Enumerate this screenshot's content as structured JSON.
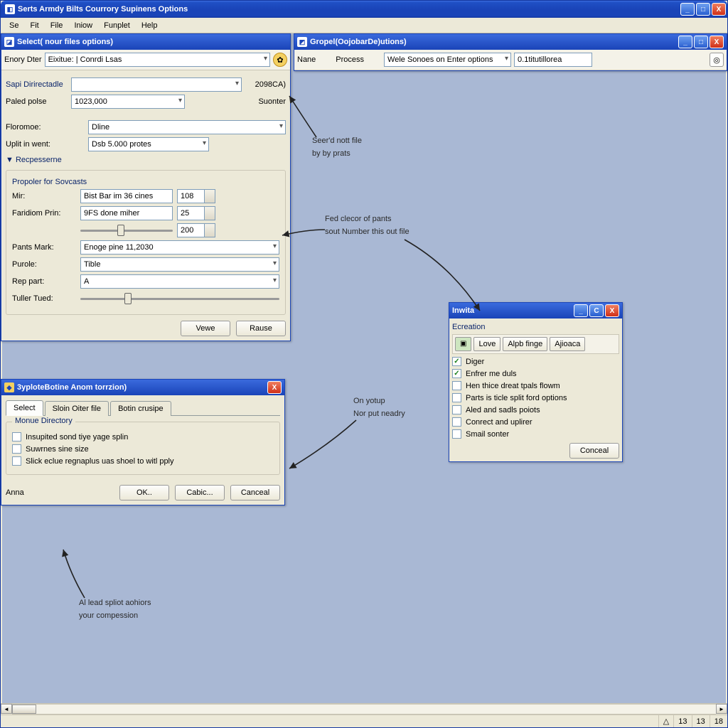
{
  "main_window": {
    "title": "Serts Armdy Bilts Courrory Supinens Options",
    "menubar": [
      "Se",
      "Fit",
      "File",
      "Iniow",
      "Funplet",
      "Help"
    ]
  },
  "panel_left": {
    "title": "Select( nour files options)",
    "toolbar_label": "Enory Dter",
    "toolbar_value": "Eixitue: | Conrdi Lsas",
    "row_sapi_label": "Sapi Dirirectadle",
    "row_sapi_value": "",
    "row_sapi_right": "2098CA)",
    "row_paled_label": "Paled polse",
    "row_paled_value": "1023,000",
    "row_paled_right": "Suonter",
    "row_roromoe": {
      "label": "Floromoe:",
      "value": "Dline"
    },
    "row_split": {
      "label": "Uplit in went:",
      "value": "Dsb 5.000 protes"
    },
    "disclosure": "▼ Recpesserne",
    "sub_title": "Propoler for Sovcasts",
    "mir_label": "Mir:",
    "mir_value": "Bist Bar im 36 cines",
    "mir_spin": "108",
    "faridiom_label": "Faridiom Prin:",
    "faridiom_value": "9FS done miher",
    "faridiom_spin": "25",
    "slider_spin": "200",
    "pants_label": "Pants Mark:",
    "pants_value": "Enoge pine 11,2030",
    "purole_label": "Purole:",
    "purole_value": "Tible",
    "rep_label": "Rep part:",
    "rep_value": "A",
    "tuller_label": "Tuller Tued:",
    "btn_vewe": "Vewe",
    "btn_rause": "Rause"
  },
  "panel_right_top": {
    "title": "Gropel(OojobarDe)utions)",
    "tb_name": "Nane",
    "tb_process": "Process",
    "tb_wele": "Wele Sonoes on Enter options",
    "tb_num": "0.1titutillorea"
  },
  "dialog_bottom": {
    "title": "3yploteBotine Anom torrzion)",
    "tabs": [
      "Select",
      "Sloin Oiter file",
      "Botin crusipe"
    ],
    "group_title": "Monue Directory",
    "chk1": "Insupited sond tiye yage splin",
    "chk2": "Suwrnes sine size",
    "chk3": "Slick eclue regnaplus uas shoel to witl pply",
    "anna": "Anna",
    "btn_ok": "OK..",
    "btn_cabic": "Cabic...",
    "btn_cancel": "Canceal"
  },
  "inwita": {
    "title": "Inwita",
    "section": "Ecreation",
    "toolbar": [
      "Love",
      "Alpb finge",
      "Ajioaca"
    ],
    "items": [
      {
        "label": "Diger",
        "checked": true
      },
      {
        "label": "Enfrer me duls",
        "checked": true
      },
      {
        "label": "Hen thice dreat tpals flowm",
        "checked": false
      },
      {
        "label": "Parts is ticle split ford options",
        "checked": false
      },
      {
        "label": "Aled and sadls poiots",
        "checked": false
      },
      {
        "label": "Conrect and uplirer",
        "checked": false
      },
      {
        "label": "Smail sonter",
        "checked": false
      }
    ],
    "btn": "Conceal"
  },
  "annotations": {
    "a1_l1": "Seer'd nott file",
    "a1_l2": "by by prats",
    "a2_l1": "Fed clecor of pants",
    "a2_l2": "sout Number this out file",
    "a3_l1": "On yotup",
    "a3_l2": "Nor put neadry",
    "a4_l1": "Al lead spliot aohiors",
    "a4_l2": "your compession"
  },
  "status": {
    "triangle": "△",
    "n1": "13",
    "n2": "13",
    "n3": "18"
  }
}
